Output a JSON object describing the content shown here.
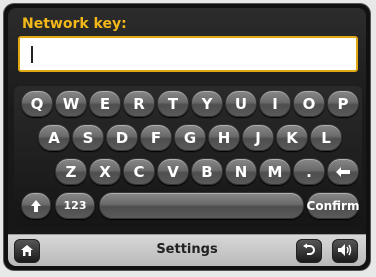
{
  "input": {
    "label": "Network key:",
    "value": ""
  },
  "keyboard": {
    "row1": [
      "Q",
      "W",
      "E",
      "R",
      "T",
      "Y",
      "U",
      "I",
      "O",
      "P"
    ],
    "row2": [
      "A",
      "S",
      "D",
      "F",
      "G",
      "H",
      "J",
      "K",
      "L"
    ],
    "row3": [
      "Z",
      "X",
      "C",
      "V",
      "B",
      "N",
      "M",
      "."
    ],
    "numbers_label": "123",
    "confirm_label": "Confirm",
    "icons": {
      "backspace": "backspace-arrow-icon",
      "shift": "shift-up-arrow-icon"
    }
  },
  "bottom_bar": {
    "title": "Settings",
    "icons": [
      "home-icon",
      "back-icon",
      "volume-icon"
    ]
  },
  "colors": {
    "label_accent": "#f2b81a",
    "field_border": "#e0a812"
  }
}
